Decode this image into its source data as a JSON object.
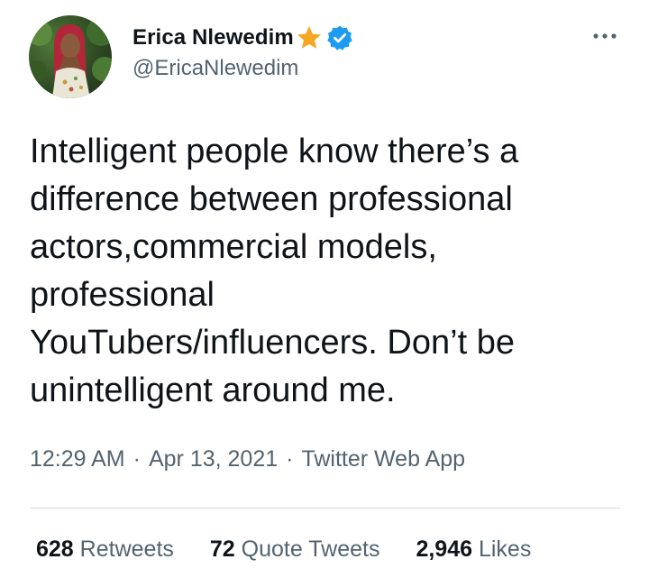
{
  "author": {
    "display_name": "Erica Nlewedim",
    "handle": "@EricaNlewedim",
    "avatar_icon": "profile-photo",
    "badge_icons": [
      "star-emoji-icon",
      "verified-badge-icon"
    ],
    "verified_color": "#1d9bf0",
    "star_color": "#f5a623"
  },
  "menu": {
    "icon": "more-options-icon"
  },
  "tweet": {
    "text": "Intelligent people know there’s a\ndifference between professional\nactors,commercial models,\nprofessional\nYouTubers/influencers. Don’t be\nunintelligent around me."
  },
  "meta": {
    "time": "12:29 AM",
    "separator": "·",
    "date": "Apr 13, 2021",
    "source": "Twitter Web App"
  },
  "stats": {
    "retweets": {
      "count": "628",
      "label": "Retweets"
    },
    "quotes": {
      "count": "72",
      "label": "Quote Tweets"
    },
    "likes": {
      "count": "2,946",
      "label": "Likes"
    }
  },
  "colors": {
    "text_primary": "#0f1419",
    "text_secondary": "#536471",
    "divider": "#cfd9de"
  }
}
